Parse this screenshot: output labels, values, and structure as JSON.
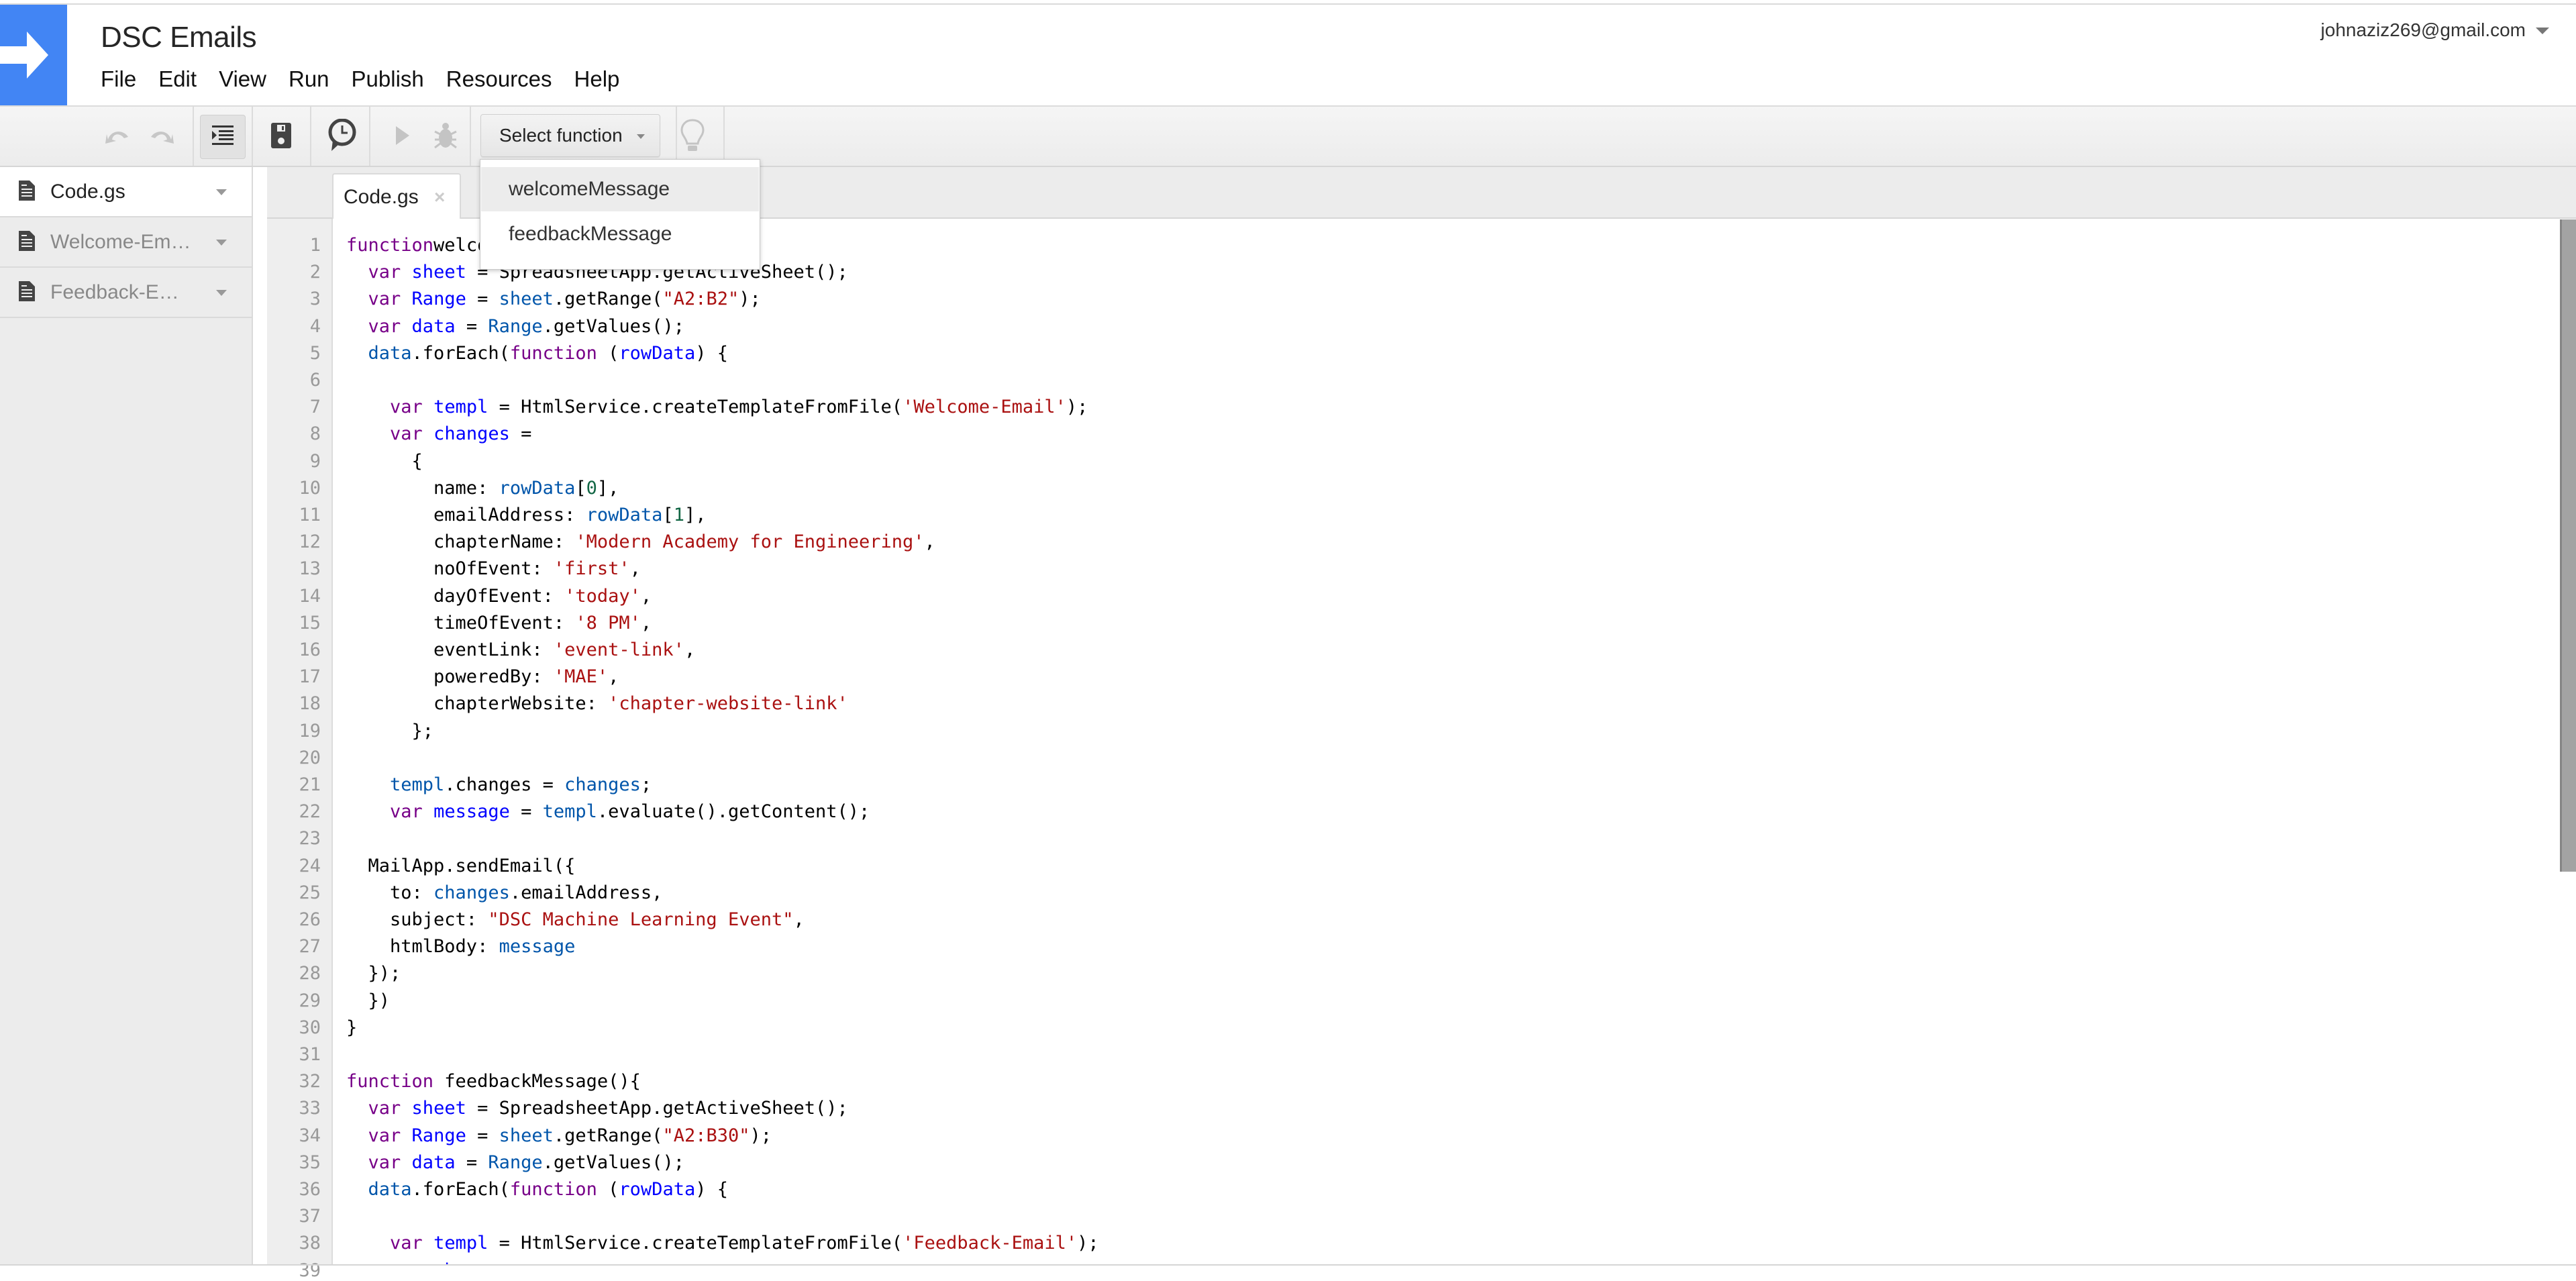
{
  "app": {
    "title": "DSC Emails",
    "account": "johnaziz269@gmail.com",
    "brand_color": "#4285f4"
  },
  "menu": [
    "File",
    "Edit",
    "View",
    "Run",
    "Publish",
    "Resources",
    "Help"
  ],
  "toolbar": {
    "icons": [
      "undo-icon",
      "redo-icon",
      "indent-icon",
      "save-icon",
      "triggers-clock-icon",
      "run-icon",
      "debug-bug-icon",
      "lightbulb-icon"
    ],
    "select_function_label": "Select function"
  },
  "function_dropdown": {
    "options": [
      "welcomeMessage",
      "feedbackMessage"
    ],
    "highlighted": "welcomeMessage"
  },
  "sidebar": {
    "files": [
      {
        "label": "Code.gs",
        "active": true
      },
      {
        "label": "Welcome-Em…",
        "active": false
      },
      {
        "label": "Feedback-E…",
        "active": false
      }
    ]
  },
  "editor": {
    "tab_label": "Code.gs",
    "tab_close": "×",
    "lines": [
      [
        [
          "kw",
          "function"
        ],
        [
          "",
          "welcomeMessage(){"
        ]
      ],
      [
        [
          "",
          "  "
        ],
        [
          "kw",
          "var"
        ],
        [
          "",
          "",
          " "
        ],
        [
          "def",
          " sheet"
        ],
        [
          "",
          " = SpreadsheetApp.getActiveSheet();"
        ]
      ],
      [
        [
          "",
          "  "
        ],
        [
          "kw",
          "var"
        ],
        [
          "def",
          " Range"
        ],
        [
          "",
          " = "
        ],
        [
          "var2",
          "sheet"
        ],
        [
          "",
          ".getRange("
        ],
        [
          "str",
          "\"A2:B2\""
        ],
        [
          "",
          ");"
        ]
      ],
      [
        [
          "",
          "  "
        ],
        [
          "kw",
          "var"
        ],
        [
          "def",
          " data"
        ],
        [
          "",
          " = "
        ],
        [
          "var2",
          "Range"
        ],
        [
          "",
          ".getValues();"
        ]
      ],
      [
        [
          "",
          "  "
        ],
        [
          "var2",
          "data"
        ],
        [
          "",
          ".forEach("
        ],
        [
          "kw",
          "function"
        ],
        [
          "",
          " ("
        ],
        [
          "def",
          "rowData"
        ],
        [
          "",
          ") {"
        ]
      ],
      [],
      [
        [
          "",
          "    "
        ],
        [
          "kw",
          "var"
        ],
        [
          "def",
          " templ"
        ],
        [
          "",
          " = HtmlService.createTemplateFromFile("
        ],
        [
          "str",
          "'Welcome-Email'"
        ],
        [
          "",
          ");"
        ]
      ],
      [
        [
          "",
          "    "
        ],
        [
          "kw",
          "var"
        ],
        [
          "def",
          " changes"
        ],
        [
          "",
          " ="
        ]
      ],
      [
        [
          "",
          "      {"
        ]
      ],
      [
        [
          "",
          "        name: "
        ],
        [
          "var2",
          "rowData"
        ],
        [
          "",
          "["
        ],
        [
          "num",
          "0"
        ],
        [
          "",
          "],"
        ]
      ],
      [
        [
          "",
          "        emailAddress: "
        ],
        [
          "var2",
          "rowData"
        ],
        [
          "",
          "["
        ],
        [
          "num",
          "1"
        ],
        [
          "",
          "],"
        ]
      ],
      [
        [
          "",
          "        chapterName: "
        ],
        [
          "str",
          "'Modern Academy for Engineering'"
        ],
        [
          "",
          ","
        ]
      ],
      [
        [
          "",
          "        noOfEvent: "
        ],
        [
          "str",
          "'first'"
        ],
        [
          "",
          ","
        ]
      ],
      [
        [
          "",
          "        dayOfEvent: "
        ],
        [
          "str",
          "'today'"
        ],
        [
          "",
          ","
        ]
      ],
      [
        [
          "",
          "        timeOfEvent: "
        ],
        [
          "str",
          "'8 PM'"
        ],
        [
          "",
          ","
        ]
      ],
      [
        [
          "",
          "        eventLink: "
        ],
        [
          "str",
          "'event-link'"
        ],
        [
          "",
          ","
        ]
      ],
      [
        [
          "",
          "        poweredBy: "
        ],
        [
          "str",
          "'MAE'"
        ],
        [
          "",
          ","
        ]
      ],
      [
        [
          "",
          "        chapterWebsite: "
        ],
        [
          "str",
          "'chapter-website-link'"
        ]
      ],
      [
        [
          "",
          "      };"
        ]
      ],
      [],
      [
        [
          "",
          "    "
        ],
        [
          "var2",
          "templ"
        ],
        [
          "",
          ".changes = "
        ],
        [
          "var2",
          "changes"
        ],
        [
          "",
          ";"
        ]
      ],
      [
        [
          "",
          "    "
        ],
        [
          "kw",
          "var"
        ],
        [
          "def",
          " message"
        ],
        [
          "",
          " = "
        ],
        [
          "var2",
          "templ"
        ],
        [
          "",
          ".evaluate().getContent();"
        ]
      ],
      [],
      [
        [
          "",
          "  MailApp.sendEmail({"
        ]
      ],
      [
        [
          "",
          "    to: "
        ],
        [
          "var2",
          "changes"
        ],
        [
          "",
          ".emailAddress,"
        ]
      ],
      [
        [
          "",
          "    subject: "
        ],
        [
          "str",
          "\"DSC Machine Learning Event\""
        ],
        [
          "",
          ","
        ]
      ],
      [
        [
          "",
          "    htmlBody: "
        ],
        [
          "var2",
          "message"
        ]
      ],
      [
        [
          "",
          "  });"
        ]
      ],
      [
        [
          "",
          "  })"
        ]
      ],
      [
        [
          "",
          "}"
        ]
      ],
      [],
      [
        [
          "kw",
          "function"
        ],
        [
          "",
          " feedbackMessage(){"
        ]
      ],
      [
        [
          "",
          "  "
        ],
        [
          "kw",
          "var"
        ],
        [
          "def",
          " sheet"
        ],
        [
          "",
          " = SpreadsheetApp.getActiveSheet();"
        ]
      ],
      [
        [
          "",
          "  "
        ],
        [
          "kw",
          "var"
        ],
        [
          "def",
          " Range"
        ],
        [
          "",
          " = "
        ],
        [
          "var2",
          "sheet"
        ],
        [
          "",
          ".getRange("
        ],
        [
          "str",
          "\"A2:B30\""
        ],
        [
          "",
          ");"
        ]
      ],
      [
        [
          "",
          "  "
        ],
        [
          "kw",
          "var"
        ],
        [
          "def",
          " data"
        ],
        [
          "",
          " = "
        ],
        [
          "var2",
          "Range"
        ],
        [
          "",
          ".getValues();"
        ]
      ],
      [
        [
          "",
          "  "
        ],
        [
          "var2",
          "data"
        ],
        [
          "",
          ".forEach("
        ],
        [
          "kw",
          "function"
        ],
        [
          "",
          " ("
        ],
        [
          "def",
          "rowData"
        ],
        [
          "",
          ") {"
        ]
      ],
      [],
      [
        [
          "",
          "    "
        ],
        [
          "kw",
          "var"
        ],
        [
          "def",
          " templ"
        ],
        [
          "",
          " = HtmlService.createTemplateFromFile("
        ],
        [
          "str",
          "'Feedback-Email'"
        ],
        [
          "",
          ");"
        ]
      ],
      [
        [
          "",
          "    "
        ],
        [
          "kw",
          "var"
        ],
        [
          "def",
          " changes"
        ],
        [
          "",
          " ="
        ]
      ]
    ]
  }
}
